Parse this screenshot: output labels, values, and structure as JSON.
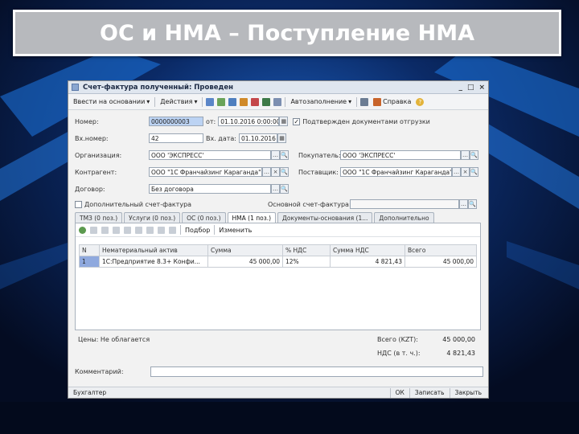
{
  "slide": {
    "title": "ОС и НМА – Поступление НМА"
  },
  "window": {
    "title": "Счет-фактура полученный: Проведен",
    "controls": {
      "minimize": "_",
      "maximize": "□",
      "close": "×"
    }
  },
  "toolbar": {
    "fill_based_on": "Ввести на основании",
    "actions": "Действия",
    "autofill": "Автозаполнение",
    "help": "Справка",
    "help_icon": "?"
  },
  "form": {
    "number_label": "Номер:",
    "number_value": "0000000003",
    "from_label": "от:",
    "from_value": "01.10.2016 0:00:00",
    "confirm_label": "Подтвержден документами отгрузки",
    "confirm_checked": "✓",
    "in_number_label": "Вх.номер:",
    "in_number_value": "42",
    "in_date_label": "Вх. дата:",
    "in_date_value": "01.10.2016",
    "org_label": "Организация:",
    "org_value": "ООО 'ЭКСПРЕСС'",
    "buyer_label": "Покупатель:",
    "buyer_value": "ООО 'ЭКСПРЕСС'",
    "contractor_label": "Контрагент:",
    "contractor_value": "ООО \"1С Франчайзинг Караганда\"",
    "supplier_label": "Поставщик:",
    "supplier_value": "ООО \"1С Франчайзинг Караганда\"",
    "contract_label": "Договор:",
    "contract_value": "Без договора",
    "additional_invoice": "Дополнительный счет-фактура",
    "main_invoice_label": "Основной счет-фактура:",
    "main_invoice_value": ""
  },
  "tabs": [
    {
      "label": "ТМЗ (0 поз.)"
    },
    {
      "label": "Услуги (0 поз.)"
    },
    {
      "label": "ОС (0 поз.)"
    },
    {
      "label": "НМА (1 поз.)"
    },
    {
      "label": "Документы-основания (1..."
    },
    {
      "label": "Дополнительно"
    }
  ],
  "subtoolbar": {
    "selection": "Подбор",
    "change": "Изменить"
  },
  "grid": {
    "headers": [
      "N",
      "Нематериальный актив",
      "Сумма",
      "% НДС",
      "Сумма НДС",
      "Всего"
    ],
    "rows": [
      {
        "n": "1",
        "asset": "1С:Предприятие 8.3+ Конфи...",
        "sum": "45 000,00",
        "vat_rate": "12%",
        "vat_sum": "4 821,43",
        "total": "45 000,00"
      }
    ]
  },
  "footer": {
    "price_label": "Цены: Не облагается",
    "total_label": "Всего (KZT):",
    "total_value": "45 000,00",
    "vat_label": "НДС (в т. ч.):",
    "vat_value": "4 821,43",
    "comment_label": "Комментарий:",
    "comment_value": ""
  },
  "status": {
    "left": "Бухгалтер",
    "ok": "ОК",
    "save": "Записать",
    "close": "Закрыть"
  },
  "colors": {
    "background": "#06122e",
    "accent_blue": "#1f6fd6",
    "title_bar": "#b7b9bd",
    "selection": "#8fa9de"
  }
}
